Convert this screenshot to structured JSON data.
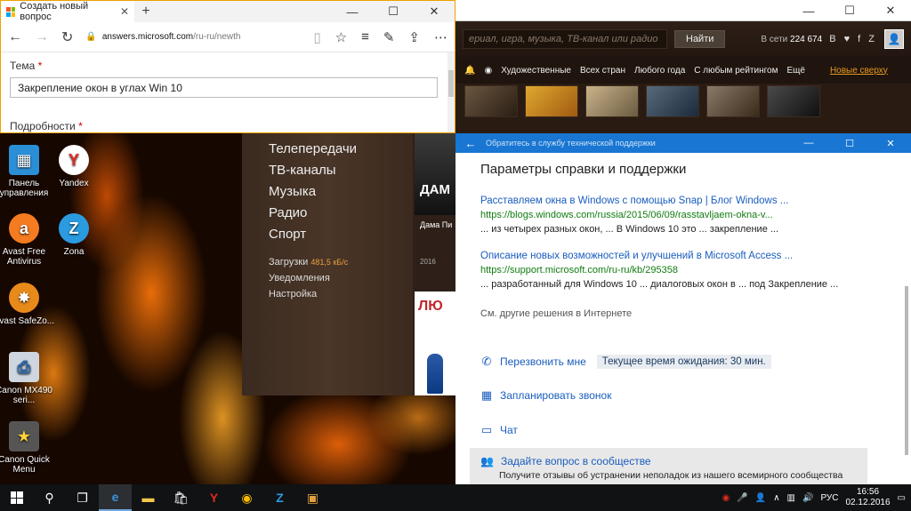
{
  "desktop_icons": [
    {
      "label": "Панель управления",
      "icon": "control-panel-icon",
      "color": "#2b8fd6"
    },
    {
      "label": "Yandex",
      "icon": "yandex-browser-icon",
      "color": "#e02b20"
    },
    {
      "label": "Avast Free Antivirus",
      "icon": "avast-icon",
      "color": "#f57b20"
    },
    {
      "label": "Zona",
      "icon": "zona-icon",
      "color": "#2a9be0"
    },
    {
      "label": "Avast SafeZo...",
      "icon": "avast-safezone-icon",
      "color": "#e88a1a"
    },
    {
      "label": "Canon MX490 seri...",
      "icon": "canon-printer-icon",
      "color": "#cfd6df"
    },
    {
      "label": "Canon Quick Menu",
      "icon": "canon-quick-menu-icon",
      "color": "#555"
    }
  ],
  "edge": {
    "tab_title": "Создать новый вопрос",
    "url_domain": "answers.microsoft.com",
    "url_rest": "/ru-ru/newth",
    "field1_label": "Тема",
    "required_mark": "*",
    "field1_value": "Закрепление окон в углах Win 10",
    "field2_label": "Подробности"
  },
  "movie_site": {
    "search_placeholder": "ериал, игра, музыка, ТВ-канал или радио",
    "find_button": "Найти",
    "online_label": "В сети",
    "online_count": "224 674",
    "social": "В ♥ f Z",
    "nav": [
      "Художественные",
      "Всех стран",
      "Любого года",
      "С любым рейтингом",
      "Ещё"
    ],
    "nav_hot": "Новые сверху"
  },
  "side_menu": {
    "items": [
      "Телепередачи",
      "ТВ-каналы",
      "Музыка",
      "Радио",
      "Спорт"
    ],
    "downloads_label": "Загрузки",
    "downloads_speed": "481,5 кБ/с",
    "notifications": "Уведомления",
    "settings": "Настройка",
    "card_text": "ДАМ",
    "card_title": "Дама Пи",
    "card_year": "2016",
    "card2_text": "ЛЮ"
  },
  "support": {
    "window_title": "Обратитесь в службу технической поддержки",
    "heading": "Параметры справки и поддержки",
    "results": [
      {
        "title": "Расставляем окна в Windows с помощью Snap | Блог Windows ...",
        "url": "https://blogs.windows.com/russia/2015/06/09/rasstavljaem-okna-v...",
        "snippet": "... из четырех разных окон, ... В Windows 10 это ... закрепление ..."
      },
      {
        "title": "Описание новых возможностей и улучшений в Microsoft Access ...",
        "url": "https://support.microsoft.com/ru-ru/kb/295358",
        "snippet": "... разработанный для Windows 10 ... диалоговых окон в ... под Закрепление ..."
      }
    ],
    "more_link": "См. другие решения в Интернете",
    "callback": "Перезвонить мне",
    "wait_time": "Текущее время ожидания: 30 мин.",
    "schedule": "Запланировать звонок",
    "chat": "Чат",
    "community_title": "Задайте вопрос в сообществе",
    "community_sub": "Получите отзывы об устранении неполадок из нашего всемирного сообщества"
  },
  "taskbar": {
    "lang": "РУС",
    "time": "16:56",
    "date": "02.12.2016"
  }
}
